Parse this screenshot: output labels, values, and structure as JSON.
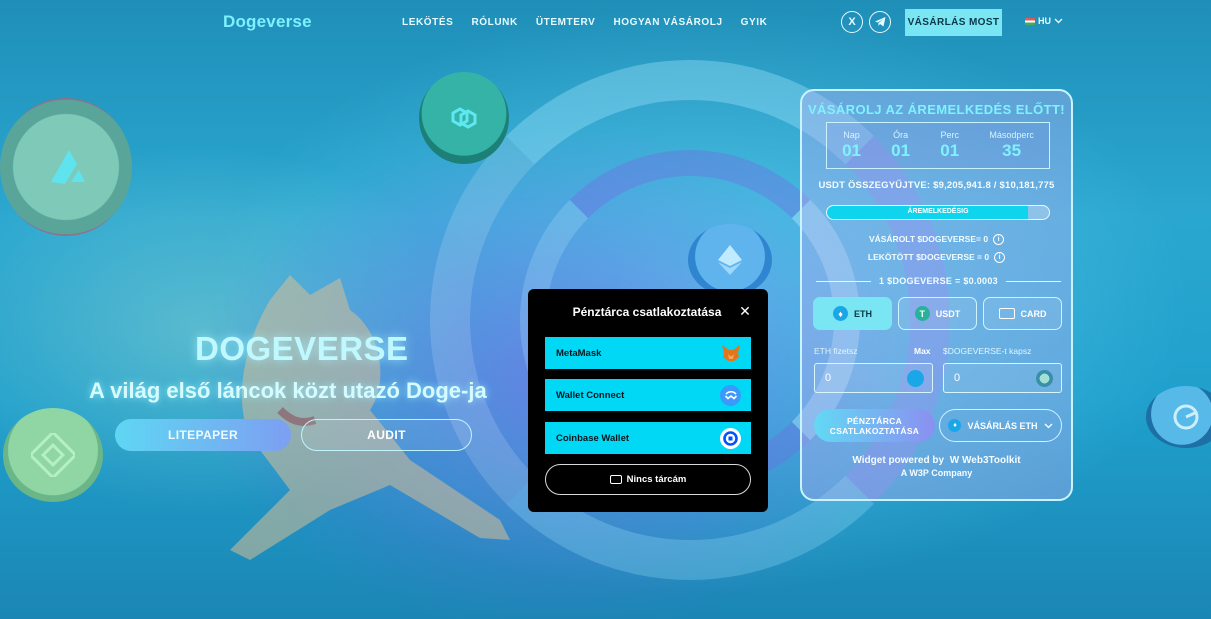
{
  "header": {
    "logo": "Dogeverse",
    "nav": [
      "LEKÖTÉS",
      "RÓLUNK",
      "ÜTEMTERV",
      "HOGYAN VÁSÁROLJ",
      "GYIK"
    ],
    "buy_now": "VÁSÁRLÁS MOST",
    "language": "HU"
  },
  "hero": {
    "title": "DOGEVERSE",
    "subtitle": "A világ első láncok közt utazó Doge-ja",
    "litepaper": "LITEPAPER",
    "audit": "AUDIT"
  },
  "widget": {
    "title": "VÁSÁROLJ AZ ÁREMELKEDÉS ELŐTT!",
    "timer": [
      {
        "label": "Nap",
        "value": "01"
      },
      {
        "label": "Óra",
        "value": "01"
      },
      {
        "label": "Perc",
        "value": "01"
      },
      {
        "label": "Másodperc",
        "value": "35"
      }
    ],
    "raised": "USDT ÖSSZEGYŰJTVE: $9,205,941.8 / $10,181,775",
    "progress_label": "ÁREMELKEDÉSIG",
    "progress_fraction": 0.904,
    "purchased": "VÁSÁROLT $DOGEVERSE= 0",
    "staked": "LEKÖTÖTT $DOGEVERSE = 0",
    "price": "1 $DOGEVERSE = $0.0003",
    "tabs": [
      "ETH",
      "USDT",
      "CARD"
    ],
    "pay_label": "ETH fizetsz",
    "max_label": "Max",
    "receive_label": "$DOGEVERSE-t kapsz",
    "pay_value": "0",
    "receive_value": "0",
    "connect_button": "PÉNZTÁRCA CSATLAKOZTATÁSA",
    "buy_eth_button": "VÁSÁRLÁS ETH",
    "powered_by": "Widget powered by",
    "toolkit": "Web3Toolkit",
    "company": "A W3P Company"
  },
  "modal": {
    "title": "Pénztárca csatlakoztatása",
    "wallets": [
      "MetaMask",
      "Wallet Connect",
      "Coinbase Wallet"
    ],
    "no_wallet": "Nincs tárcám"
  },
  "colors": {
    "accent": "#7be6f3",
    "wallet_button": "#00d8f6",
    "modal_bg": "#000000"
  }
}
